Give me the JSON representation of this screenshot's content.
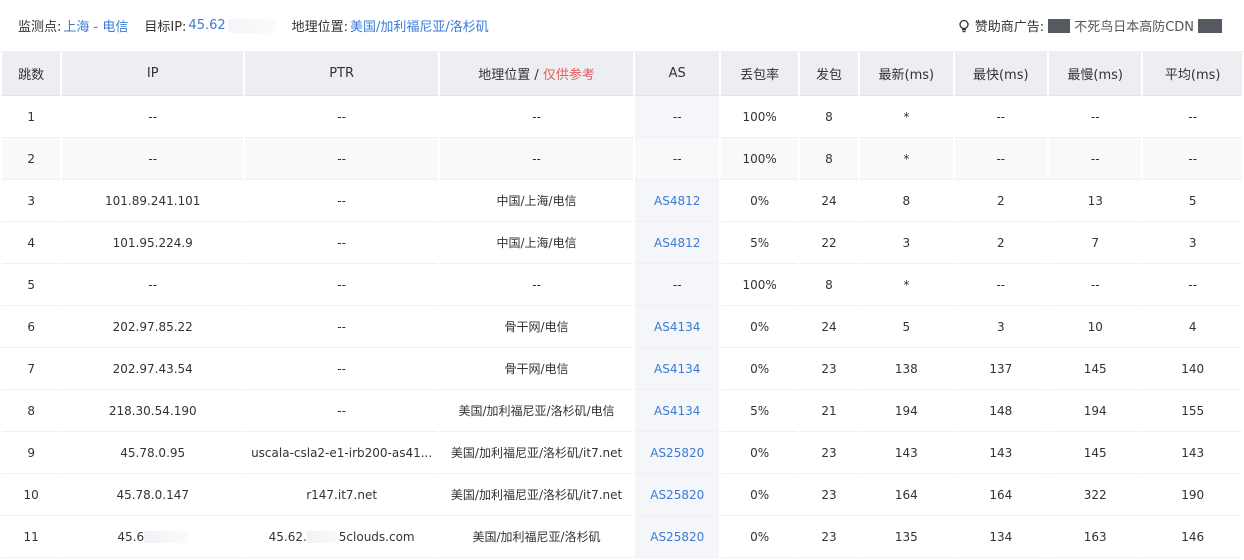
{
  "header": {
    "monitor_label": "监测点:",
    "monitor_value": "上海 - 电信",
    "target_label": "目标IP:",
    "target_value": "45.62",
    "geo_label": "地理位置:",
    "geo_value": "美国/加利福尼亚/洛杉矶",
    "sponsor_label": "赞助商广告:",
    "sponsor_text": "不死鸟日本高防CDN"
  },
  "columns": [
    "跳数",
    "IP",
    "PTR",
    "地理位置",
    "AS",
    "丢包率",
    "发包",
    "最新(ms)",
    "最快(ms)",
    "最慢(ms)",
    "平均(ms)"
  ],
  "geo_ref": "仅供参考",
  "rows": [
    {
      "hop": "1",
      "ip": "--",
      "ptr": "--",
      "geo": "--",
      "as": "--",
      "loss": "100%",
      "sent": "8",
      "last": "*",
      "best": "--",
      "worst": "--",
      "avg": "--"
    },
    {
      "hop": "2",
      "ip": "--",
      "ptr": "--",
      "geo": "--",
      "as": "--",
      "loss": "100%",
      "sent": "8",
      "last": "*",
      "best": "--",
      "worst": "--",
      "avg": "--"
    },
    {
      "hop": "3",
      "ip": "101.89.241.101",
      "ptr": "--",
      "geo": "中国/上海/电信",
      "as": "AS4812",
      "loss": "0%",
      "sent": "24",
      "last": "8",
      "best": "2",
      "worst": "13",
      "avg": "5"
    },
    {
      "hop": "4",
      "ip": "101.95.224.9",
      "ptr": "--",
      "geo": "中国/上海/电信",
      "as": "AS4812",
      "loss": "5%",
      "sent": "22",
      "last": "3",
      "best": "2",
      "worst": "7",
      "avg": "3"
    },
    {
      "hop": "5",
      "ip": "--",
      "ptr": "--",
      "geo": "--",
      "as": "--",
      "loss": "100%",
      "sent": "8",
      "last": "*",
      "best": "--",
      "worst": "--",
      "avg": "--"
    },
    {
      "hop": "6",
      "ip": "202.97.85.22",
      "ptr": "--",
      "geo": "骨干网/电信",
      "as": "AS4134",
      "loss": "0%",
      "sent": "24",
      "last": "5",
      "best": "3",
      "worst": "10",
      "avg": "4"
    },
    {
      "hop": "7",
      "ip": "202.97.43.54",
      "ptr": "--",
      "geo": "骨干网/电信",
      "as": "AS4134",
      "loss": "0%",
      "sent": "23",
      "last": "138",
      "best": "137",
      "worst": "145",
      "avg": "140"
    },
    {
      "hop": "8",
      "ip": "218.30.54.190",
      "ptr": "--",
      "geo": "美国/加利福尼亚/洛杉矶/电信",
      "as": "AS4134",
      "loss": "5%",
      "sent": "21",
      "last": "194",
      "best": "148",
      "worst": "194",
      "avg": "155"
    },
    {
      "hop": "9",
      "ip": "45.78.0.95",
      "ptr": "uscala-csla2-e1-irb200-as41...",
      "geo": "美国/加利福尼亚/洛杉矶/it7.net",
      "as": "AS25820",
      "loss": "0%",
      "sent": "23",
      "last": "143",
      "best": "143",
      "worst": "145",
      "avg": "143"
    },
    {
      "hop": "10",
      "ip": "45.78.0.147",
      "ptr": "r147.it7.net",
      "geo": "美国/加利福尼亚/洛杉矶/it7.net",
      "as": "AS25820",
      "loss": "0%",
      "sent": "23",
      "last": "164",
      "best": "164",
      "worst": "322",
      "avg": "190"
    },
    {
      "hop": "11",
      "ip": "45.6",
      "ptr": "45.62.",
      "ptr_suffix": "5clouds.com",
      "geo": "美国/加利福尼亚/洛杉矶",
      "as": "AS25820",
      "loss": "0%",
      "sent": "23",
      "last": "135",
      "best": "134",
      "worst": "163",
      "avg": "146"
    }
  ],
  "colors": {
    "accent": "#3a7bd5",
    "ref": "#e35d5d"
  }
}
